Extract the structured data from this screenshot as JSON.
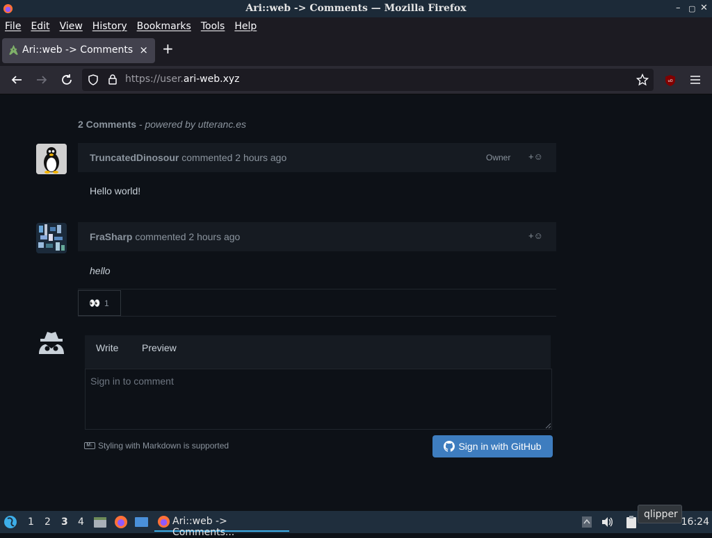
{
  "window": {
    "title": "Ari::web -> Comments — Mozilla Firefox",
    "controls": [
      "–",
      "▢",
      "✕"
    ]
  },
  "menu": [
    "File",
    "Edit",
    "View",
    "History",
    "Bookmarks",
    "Tools",
    "Help"
  ],
  "tab": {
    "title": "Ari::web -> Comments",
    "close": "×",
    "new_tab": "+"
  },
  "nav": {
    "url_prefix": "https://user.",
    "url_domain": "ari-web.xyz",
    "back_icon": "arrow-left",
    "forward_icon": "arrow-right",
    "reload_icon": "reload",
    "bookmark_icon": "star",
    "menu_icon": "hamburger"
  },
  "comments_section": {
    "count_label": "2 Comments",
    "powered_by": "- powered by utteranc.es",
    "comments": [
      {
        "author": "TruncatedDinosour",
        "action": "commented 2 hours ago",
        "badge": "Owner",
        "reaction_add": "+☺",
        "body": "Hello world!"
      },
      {
        "author": "FraSharp",
        "action": "commented 2 hours ago",
        "badge": "",
        "reaction_add": "+☺",
        "body": "hello",
        "reactions": [
          {
            "emoji": "👀",
            "count": "1"
          }
        ]
      }
    ],
    "editor": {
      "tab_write": "Write",
      "tab_preview": "Preview",
      "placeholder": "Sign in to comment",
      "markdown_hint": "Styling with Markdown is supported",
      "markdown_icon_text": "M↓",
      "signin_label": "Sign in with GitHub"
    }
  },
  "taskbar": {
    "desktops": [
      "1",
      "2",
      "3",
      "4"
    ],
    "active_desktop": "3",
    "task_label": "Ari::web -> Comments...",
    "clock": "16:24",
    "tooltip": "qlipper"
  },
  "colors": {
    "page_bg": "#0d1117",
    "comment_header_bg": "#161b22",
    "signin_button": "#3e7dbf",
    "taskbar_accent": "#3daee9"
  }
}
